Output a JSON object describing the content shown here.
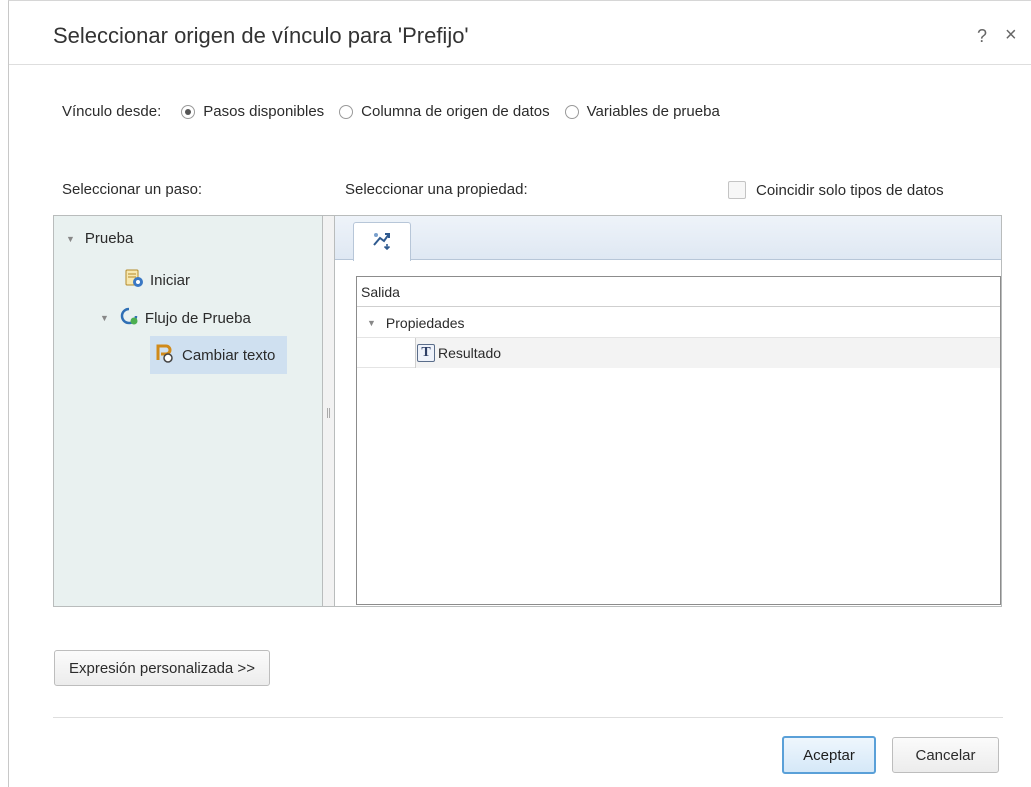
{
  "dialog": {
    "title": "Seleccionar origen de vínculo para 'Prefijo'",
    "help_icon": "?",
    "close_icon": "×"
  },
  "link_from": {
    "label": "Vínculo desde:",
    "options": [
      {
        "label": "Pasos disponibles",
        "checked": true
      },
      {
        "label": "Columna de origen de datos",
        "checked": false
      },
      {
        "label": "Variables de prueba",
        "checked": false
      }
    ]
  },
  "step_panel": {
    "label": "Seleccionar un paso:",
    "tree": [
      {
        "label": "Prueba",
        "icon": "collapse-triangle",
        "expanded": true
      },
      {
        "label": "Iniciar",
        "icon": "start-script-icon"
      },
      {
        "label": "Flujo de Prueba",
        "icon": "flow-icon",
        "expanded": true
      },
      {
        "label": "Cambiar texto",
        "icon": "change-text-icon",
        "selected": true
      }
    ]
  },
  "property_panel": {
    "label": "Seleccionar una propiedad:",
    "match_types_label": "Coincidir solo tipos de datos",
    "match_types_checked": false,
    "tab_icon": "output-properties-icon",
    "grid": {
      "header": "Salida",
      "rows": [
        {
          "label": "Propiedades",
          "expanded": true
        },
        {
          "label": "Resultado",
          "icon": "text-type-icon",
          "icon_glyph": "T"
        }
      ]
    }
  },
  "buttons": {
    "custom_expression": "Expresión personalizada >>",
    "ok": "Aceptar",
    "cancel": "Cancelar"
  },
  "colors": {
    "tree_bg": "#e9f1f0",
    "selection": "#cfe0f0",
    "ok_border": "#5aa0d8"
  }
}
